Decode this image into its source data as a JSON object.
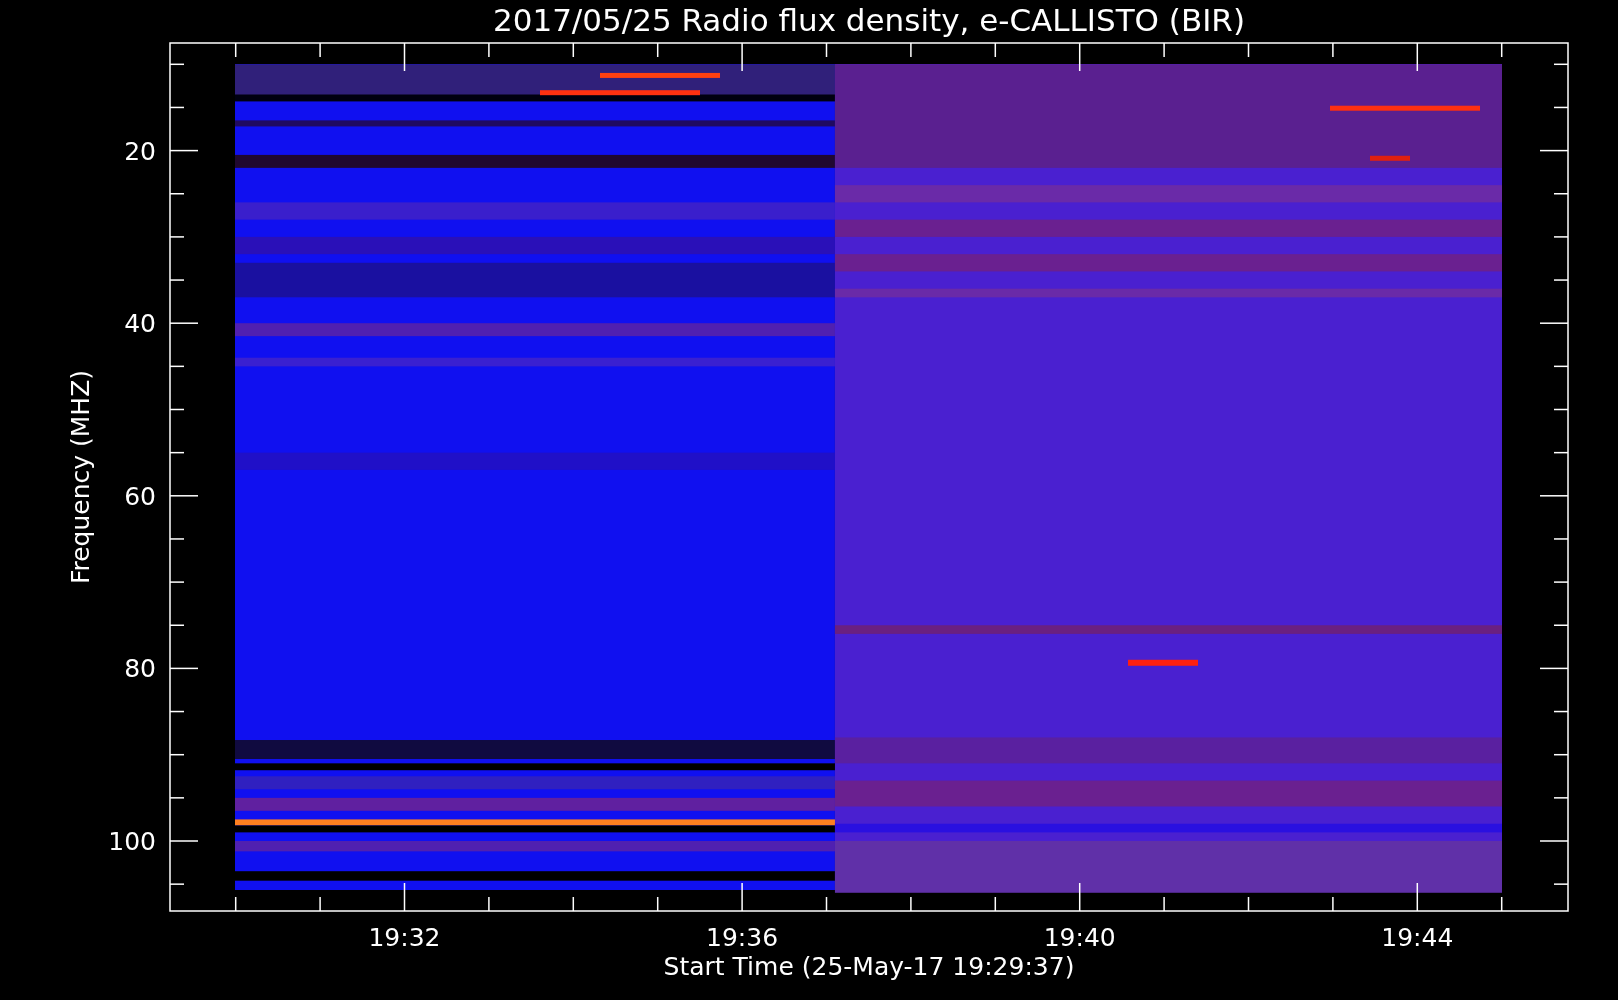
{
  "plot": {
    "title": "2017/05/25  Radio flux density, e-CALLISTO (BIR)",
    "xlabel": "Start Time (25-May-17 19:29:37)",
    "ylabel": "Frequency (MHZ)",
    "xticks": [
      "19:32",
      "19:36",
      "19:40",
      "19:44"
    ],
    "yticks": [
      "20",
      "40",
      "60",
      "80",
      "100"
    ]
  }
}
